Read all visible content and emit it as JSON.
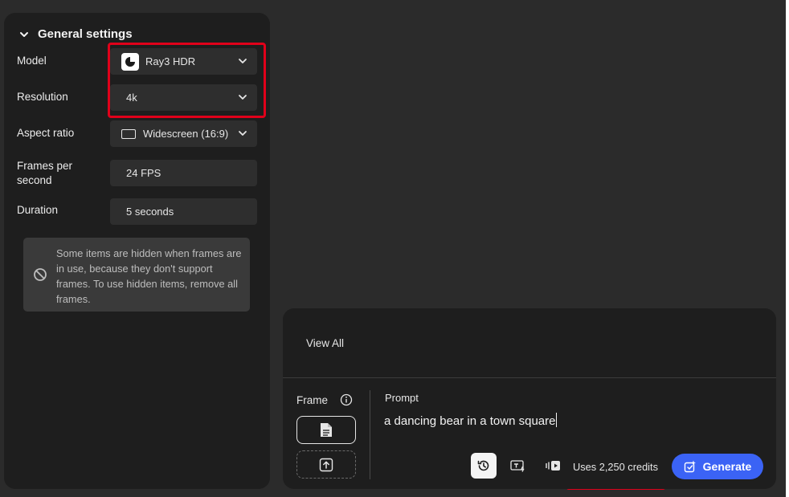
{
  "settings": {
    "section_title": "General settings",
    "model": {
      "label": "Model",
      "value": "Ray3 HDR"
    },
    "resolution": {
      "label": "Resolution",
      "value": "4k"
    },
    "aspect_ratio": {
      "label": "Aspect ratio",
      "value": "Widescreen (16:9)"
    },
    "fps": {
      "label_line1": "Frames per",
      "label_line2": "second",
      "value": "24 FPS"
    },
    "duration": {
      "label": "Duration",
      "value": "5 seconds"
    },
    "notice": "Some items are hidden when frames are in use, because they don't support frames. To use hidden items, remove all frames."
  },
  "prompt_panel": {
    "view_all": "View All",
    "frame_label": "Frame",
    "prompt_label": "Prompt",
    "prompt_text": "a dancing bear in a town square",
    "credits": "Uses 2,250 credits",
    "generate_label": "Generate"
  },
  "icons": [
    "chevron-down-icon",
    "model-logo-icon",
    "aspect-ratio-icon",
    "ban-icon",
    "info-icon",
    "document-icon",
    "upload-icon",
    "history-icon",
    "text-effects-icon",
    "video-settings-icon",
    "generate-sparkle-icon"
  ],
  "colors": {
    "accent": "#3b63f5",
    "annotation": "#e0001a",
    "panel": "#1e1e1e",
    "background": "#2b2b2b"
  }
}
